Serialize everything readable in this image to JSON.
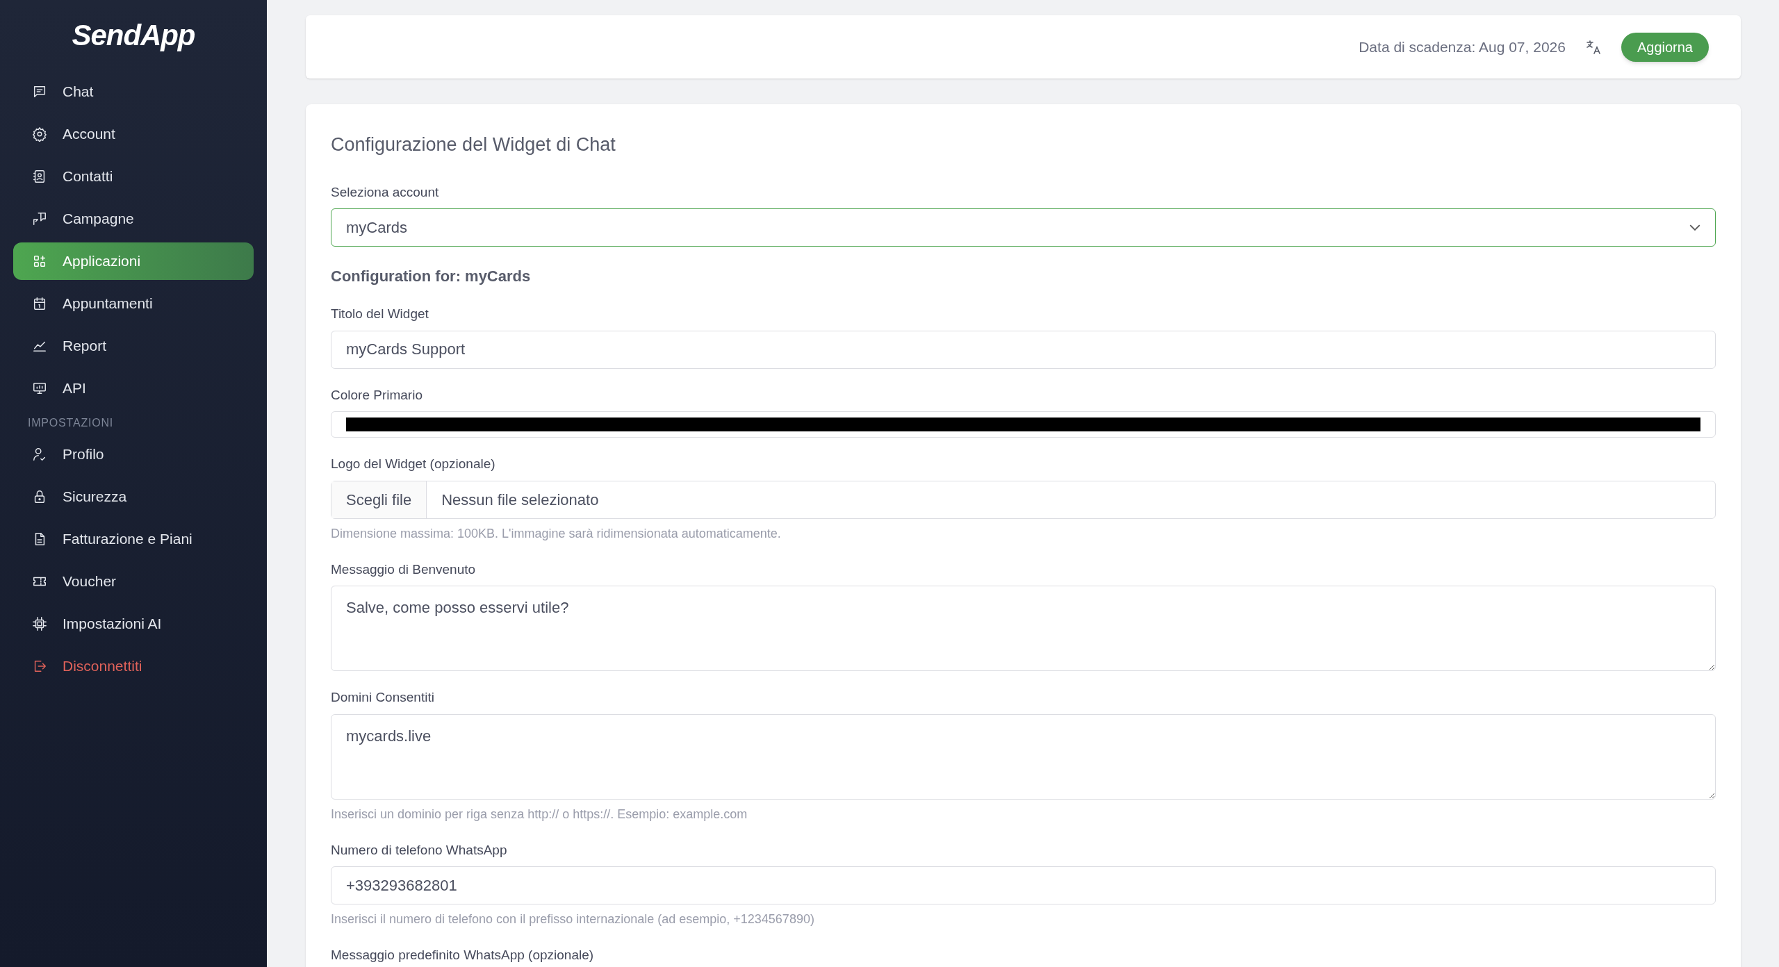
{
  "sidebar": {
    "logo": "SendApp",
    "items": [
      {
        "kind": "link",
        "label": "Chat",
        "selected": false
      },
      {
        "kind": "link",
        "label": "Account",
        "selected": false
      },
      {
        "kind": "link",
        "label": "Contatti",
        "selected": false
      },
      {
        "kind": "link",
        "label": "Campagne",
        "selected": false
      },
      {
        "kind": "link",
        "label": "Applicazioni",
        "selected": true
      },
      {
        "kind": "link",
        "label": "Appuntamenti",
        "selected": false
      },
      {
        "kind": "link",
        "label": "Report",
        "selected": false
      },
      {
        "kind": "link",
        "label": "API",
        "selected": false
      },
      {
        "kind": "heading",
        "label": "IMPOSTAZIONI"
      },
      {
        "kind": "link",
        "label": "Profilo",
        "selected": false
      },
      {
        "kind": "link",
        "label": "Sicurezza",
        "selected": false
      },
      {
        "kind": "link",
        "label": "Fatturazione e Piani",
        "selected": false
      },
      {
        "kind": "link",
        "label": "Voucher",
        "selected": false
      },
      {
        "kind": "link",
        "label": "Impostazioni AI",
        "selected": false
      },
      {
        "kind": "logout",
        "label": "Disconnettiti",
        "selected": false
      }
    ]
  },
  "header": {
    "expiry": "Data di scadenza: Aug 07, 2026",
    "button": "Aggiorna"
  },
  "form": {
    "title": "Configurazione del Widget di Chat",
    "fields": [
      {
        "kind": "select",
        "label": "Seleziona account",
        "value": "myCards"
      },
      {
        "kind": "subheading",
        "label": "Configuration for: myCards"
      },
      {
        "kind": "text",
        "label": "Titolo del Widget",
        "value": "myCards Support"
      },
      {
        "kind": "color",
        "label": "Colore Primario",
        "color": "#000000"
      },
      {
        "kind": "file",
        "label": "Logo del Widget (opzionale)",
        "button": "Scegli file",
        "value": "Nessun file selezionato",
        "help": "Dimensione massima: 100KB. L'immagine sarà ridimensionata automaticamente."
      },
      {
        "kind": "textarea",
        "label": "Messaggio di Benvenuto",
        "value": "Salve, come posso esservi utile?"
      },
      {
        "kind": "textarea",
        "label": "Domini Consentiti",
        "value": "mycards.live",
        "help": "Inserisci un dominio per riga senza http:// o https://. Esempio: example.com"
      },
      {
        "kind": "text",
        "label": "Numero di telefono WhatsApp",
        "value": "+393293682801",
        "help": "Inserisci il numero di telefono con il prefisso internazionale (ad esempio, +1234567890)"
      },
      {
        "kind": "label",
        "label": "Messaggio predefinito WhatsApp (opzionale)"
      }
    ]
  }
}
